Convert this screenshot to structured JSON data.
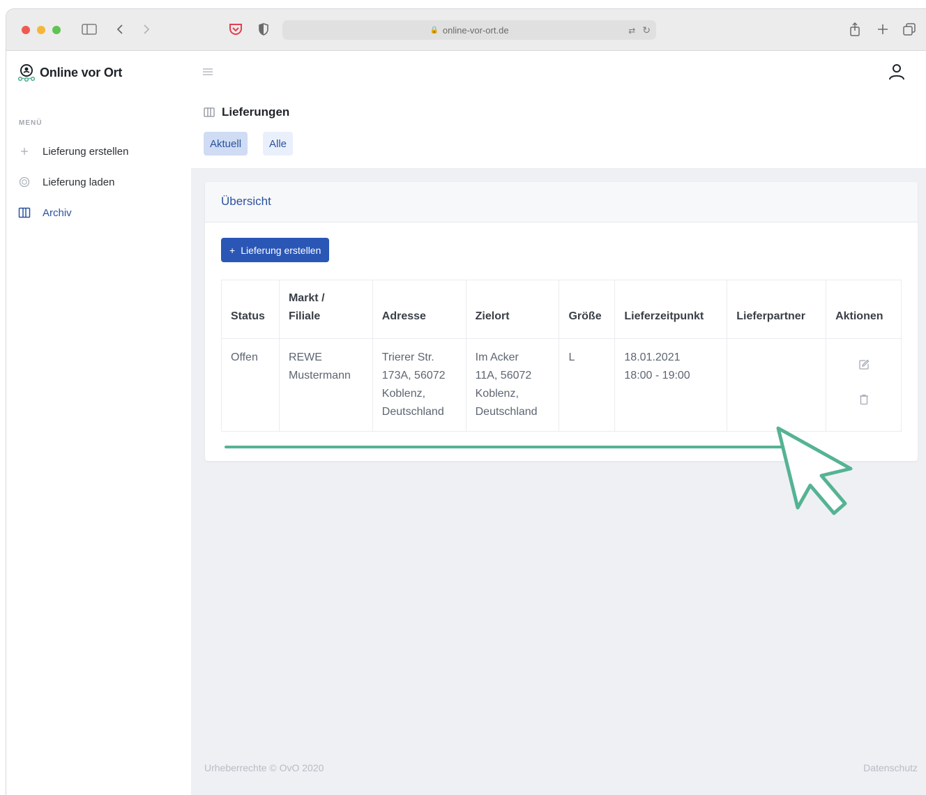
{
  "browser": {
    "url": "online-vor-ort.de"
  },
  "app": {
    "name": "Online vor Ort"
  },
  "sidebar": {
    "heading": "MENÜ",
    "items": [
      {
        "label": "Lieferung erstellen",
        "icon": "plus-icon"
      },
      {
        "label": "Lieferung laden",
        "icon": "box-icon"
      },
      {
        "label": "Archiv",
        "icon": "archive-icon",
        "active": true
      }
    ]
  },
  "page": {
    "title": "Lieferungen",
    "tabs": [
      {
        "label": "Aktuell",
        "active": true
      },
      {
        "label": "Alle",
        "active": false
      }
    ]
  },
  "card": {
    "title": "Übersicht",
    "create_button": "Lieferung erstellen",
    "table": {
      "headers": {
        "status": "Status",
        "markt_line1": "Markt /",
        "markt_line2": "Filiale",
        "adresse": "Adresse",
        "zielort": "Zielort",
        "groesse": "Größe",
        "lieferzeitpunkt": "Lieferzeitpunkt",
        "lieferpartner": "Lieferpartner",
        "aktionen": "Aktionen"
      },
      "rows": [
        {
          "status": "Offen",
          "markt_1": "REWE",
          "markt_2": "Mustermann",
          "adresse_1": "Trierer Str.",
          "adresse_2": "173A, 56072",
          "adresse_3": "Koblenz,",
          "adresse_4": "Deutschland",
          "zielort_1": "Im Acker",
          "zielort_2": "11A, 56072",
          "zielort_3": "Koblenz,",
          "zielort_4": "Deutschland",
          "groesse": "L",
          "datum": "18.01.2021",
          "zeit": "18:00 - 19:00",
          "lieferpartner": ""
        }
      ]
    }
  },
  "footer": {
    "copyright": "Urheberrechte © OvO 2020",
    "privacy": "Datenschutz"
  },
  "colors": {
    "primary": "#2a56b5",
    "accent_green": "#55b393",
    "link_blue": "#2a52a0"
  }
}
